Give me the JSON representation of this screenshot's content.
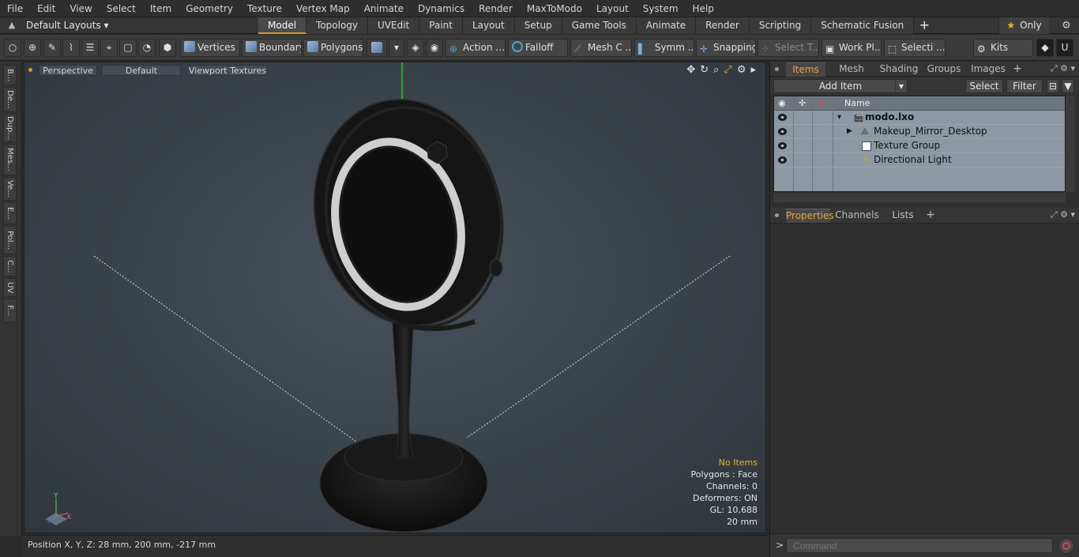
{
  "menu": [
    "File",
    "Edit",
    "View",
    "Select",
    "Item",
    "Geometry",
    "Texture",
    "Vertex Map",
    "Animate",
    "Dynamics",
    "Render",
    "MaxToModo",
    "Layout",
    "System",
    "Help"
  ],
  "layout_bar": {
    "layout_dropdown": "Default Layouts",
    "tabs": [
      "Model",
      "Topology",
      "UVEdit",
      "Paint",
      "Layout",
      "Setup",
      "Game Tools",
      "Animate",
      "Render",
      "Scripting",
      "Schematic Fusion"
    ],
    "active_tab": "Model",
    "only_label": "Only"
  },
  "toolbar": {
    "vertices": "Vertices",
    "boundary": "Boundary",
    "polygons": "Polygons",
    "action": "Action",
    "falloff": "Falloff",
    "mesh_c": "Mesh C ...",
    "symm": "Symm ...",
    "snapping": "Snapping",
    "select_t": "Select T...",
    "work_pl": "Work Pl...",
    "selecti": "Selecti ...",
    "kits": "Kits"
  },
  "left_strip": [
    "B...",
    "De...",
    "Dup...",
    "Mes...",
    "Ve...",
    "E...",
    "Pol...",
    "C...",
    "UV",
    "F..."
  ],
  "viewport": {
    "view_mode": "Perspective",
    "shading": "Default",
    "textures": "Viewport Textures",
    "info": {
      "selection": "No Items",
      "polygons": "Polygons : Face",
      "channels": "Channels: 0",
      "deformers": "Deformers: ON",
      "gl": "GL: 10,688",
      "scale": "20 mm"
    },
    "axis": {
      "y": "Y",
      "x": "X"
    }
  },
  "status_bar": {
    "position": "Position X, Y, Z:   28 mm, 200 mm, -217 mm"
  },
  "items_panel": {
    "tabs": [
      "Items",
      "Mesh Ops",
      "Shading",
      "Groups",
      "Images"
    ],
    "active_tab": "Items",
    "add_item": "Add Item",
    "select": "Select",
    "filter": "Filter",
    "column_name": "Name",
    "rows": [
      {
        "name": "modo.lxo",
        "kind": "scene"
      },
      {
        "name": "Makeup_Mirror_Desktop",
        "kind": "mesh"
      },
      {
        "name": "Texture Group",
        "kind": "texture"
      },
      {
        "name": "Directional Light",
        "kind": "light"
      }
    ]
  },
  "properties_panel": {
    "tabs": [
      "Properties",
      "Channels",
      "Lists"
    ],
    "active_tab": "Properties"
  },
  "command": {
    "placeholder": "Command"
  },
  "colors": {
    "accent": "#d8962c",
    "viewport_bg": "#3a4249",
    "item_list_bg": "#8e98a2"
  }
}
